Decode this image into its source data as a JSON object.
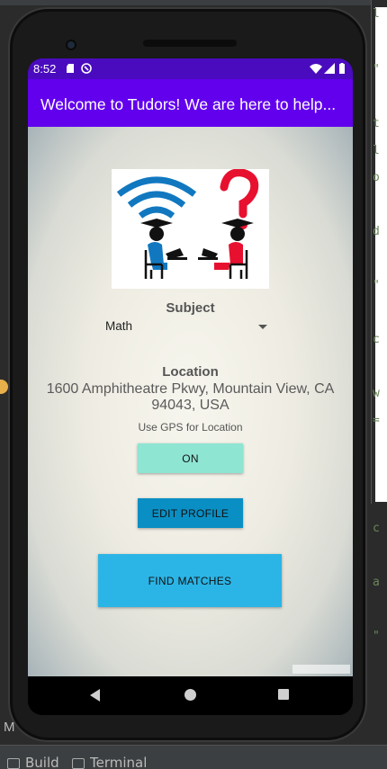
{
  "status_bar": {
    "time": "8:52"
  },
  "app_bar": {
    "title": "Welcome to Tudors! We are here to help..."
  },
  "subject": {
    "label": "Subject",
    "selected": "Math"
  },
  "location": {
    "label": "Location",
    "address": "1600 Amphitheatre Pkwy, Mountain View, CA 94043, USA"
  },
  "gps": {
    "label": "Use GPS for Location",
    "toggle_text": "ON"
  },
  "buttons": {
    "edit_profile": "EDIT PROFILE",
    "find_matches": "FIND MATCHES"
  },
  "ide": {
    "build_tab": "Build",
    "terminal_tab": "Terminal"
  },
  "colors": {
    "status_bar": "#4a0bbf",
    "app_bar": "#6200ee",
    "on_button": "#8ee5d2",
    "edit_button": "#0a8fc4",
    "find_button": "#2bb5e6",
    "logo_blue": "#1178c0",
    "logo_red": "#e8102f"
  }
}
